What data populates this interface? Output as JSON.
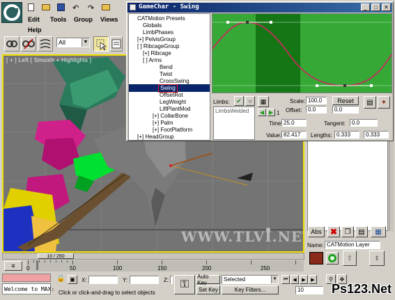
{
  "menu": {
    "edit": "Edit",
    "tools": "Tools",
    "group": "Group",
    "views": "Views",
    "help": "Help"
  },
  "toolbar": {
    "filter_value": "All"
  },
  "viewport": {
    "label": "[ + ] Left [ Smooth + Highlights ]",
    "watermark": "WWW.TLVI.NET"
  },
  "catwindow": {
    "title": "GameChar - Swing",
    "tree": [
      "CATMotion Presets",
      "Globals",
      "LimbPhases",
      "[+] PelvisGroup",
      "[ ] RibcageGroup",
      "[+] Ribcage",
      "[ ] Arms",
      "Bend",
      "Twist",
      "CrossSwing",
      "Swing",
      "OffsetRot",
      "LegWeight",
      "LiftPlantMod",
      "[+] CollarBone",
      "[+] Palm",
      "[+] FootPlatform",
      "[+] HeadGroup"
    ],
    "limbs_label": "Limbs:",
    "limbs_item": "LimbsWelded",
    "limb_number": "1",
    "scale_label": "Scale:",
    "scale_value": "100.0",
    "reset_label": "Reset",
    "offset_label": "Offset:",
    "offset_value_1": "0.0",
    "offset_value_2": "0.0",
    "time_label": "Time:",
    "time_value": "25.0",
    "tangent_label": "Tangent:",
    "tangent_value": "0.0",
    "value_label": "Value:",
    "value_value": "82.417",
    "lengths_label": "Lengths:",
    "length_value_1": "0.333",
    "length_value_2": "0.333"
  },
  "command_panel": {
    "name_label": "Name:",
    "name_value": "CATMotion Layer",
    "abs_label": "Abs"
  },
  "timeline": {
    "counter": "10 / 260",
    "ticks": [
      "0",
      "50",
      "100",
      "150",
      "200",
      "250"
    ]
  },
  "status": {
    "maxscript": "Welcome to MAX:",
    "x_label": "X:",
    "y_label": "Y:",
    "z_label": "Z:",
    "auto_key": "Auto Key",
    "selected": "Selected",
    "set_key": "Set Key",
    "key_filters": "Key Filters...",
    "prompt": "Click or click-and-drag to select objects",
    "frame_value": "10",
    "watermark": "Ps123.Net"
  },
  "colors": {
    "graph_bg": "#36a836",
    "graph_dark": "#157615",
    "curve": "#c0305a",
    "viewport_border": "#f0e000",
    "title_bar": "#0a246a"
  }
}
